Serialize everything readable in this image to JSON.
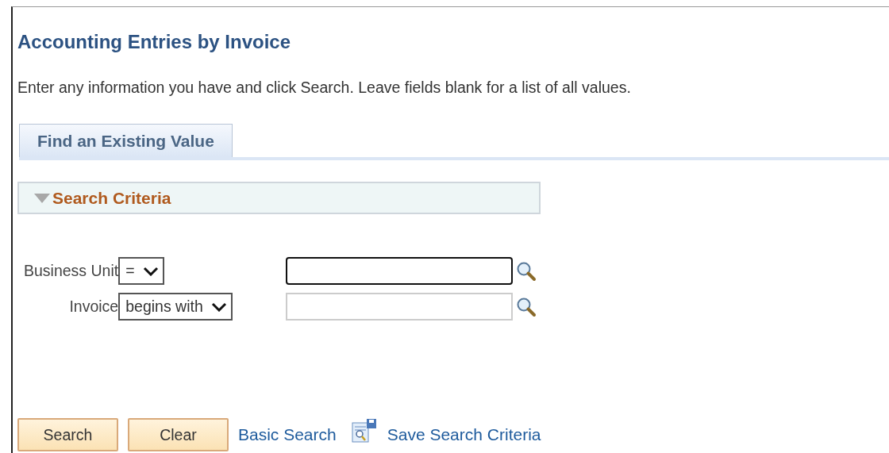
{
  "title": "Accounting Entries by Invoice",
  "instructions": "Enter any information you have and click Search. Leave fields blank for a list of all values.",
  "tabs": [
    {
      "label": "Find an Existing Value",
      "selected": true
    }
  ],
  "section": {
    "title": "Search Criteria",
    "expanded": true
  },
  "fields": [
    {
      "label": "Business Unit",
      "operator": "=",
      "focused": true
    },
    {
      "label": "Invoice",
      "operator": "begins with",
      "focused": false
    }
  ],
  "buttons": [
    "Search",
    "Clear"
  ],
  "links": [
    {
      "kind": "text",
      "label": "Basic Search"
    },
    {
      "kind": "icon-text",
      "label": "Save Search Criteria"
    }
  ]
}
